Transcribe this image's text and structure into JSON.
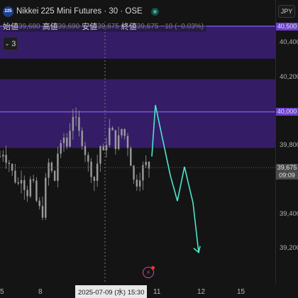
{
  "chart": {
    "symbol_badge": "225",
    "symbol_title": "Nikkei 225 Mini Futures · 30 · OSE",
    "currency": "JPY",
    "collapse_count": "3",
    "ohlc": [
      {
        "label": "始値",
        "value": "39,680"
      },
      {
        "label": "高値",
        "value": "39,690"
      },
      {
        "label": "安値",
        "value": "39,675"
      },
      {
        "label": "終値",
        "value": "39,675"
      }
    ],
    "change": "−10 (−0.03%)",
    "price_axis": [
      {
        "label": "40,400",
        "price": 40400
      },
      {
        "label": "40,200",
        "price": 40200
      },
      {
        "label": "39,800",
        "price": 39800
      },
      {
        "label": "39,400",
        "price": 39400
      },
      {
        "label": "39,200",
        "price": 39200
      }
    ],
    "price_tags": {
      "top": "40,500",
      "mid": "40,000",
      "last_price": "39,675",
      "countdown": "09:09"
    },
    "time_axis": [
      {
        "label": "5"
      },
      {
        "label": "8"
      },
      {
        "label": "11"
      },
      {
        "label": "12"
      },
      {
        "label": "15"
      }
    ],
    "crosshair_label": "2025-07-09 (水)   15:30",
    "colors": {
      "zone_fill": "#341d66",
      "zone_line": "#7b52e0",
      "candles": "#9a9a9a",
      "projection": "#4ee6c8",
      "last_price_line": "#5a5a5a"
    },
    "icons": {
      "alert": "flash-alert-icon",
      "collapse": "chevron-down-icon"
    }
  },
  "chart_data": {
    "type": "line",
    "title": "Nikkei 225 Mini Futures · 30 · OSE",
    "xlabel": "",
    "ylabel": "",
    "ylim": [
      39100,
      40550
    ],
    "zones": [
      {
        "from": 40310,
        "to": 40500
      },
      {
        "from": 39790,
        "to": 40190
      }
    ],
    "levels": [
      40500,
      40000
    ],
    "last_price": 39675,
    "projection": {
      "name": "",
      "values": [
        39740,
        40040,
        39630,
        39480,
        39680,
        39470,
        39180
      ]
    }
  }
}
